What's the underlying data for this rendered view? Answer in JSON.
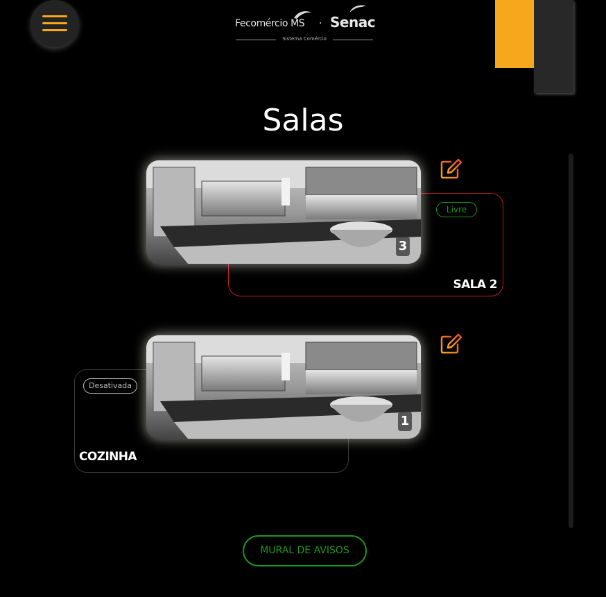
{
  "header": {
    "menu_icon": "hamburger-menu-icon",
    "logo": {
      "fecomercio": "Fecomércio MS",
      "separator": "·",
      "senac": "Senac",
      "tagline": "Sistema Comércio"
    }
  },
  "page": {
    "title": "Salas"
  },
  "rooms": [
    {
      "name": "SALA 2",
      "status": "Livre",
      "count": "3",
      "status_color": "#1e9a1e",
      "border_color": "#c31a24",
      "edit_icon": "edit-pencil-icon"
    },
    {
      "name": "COZINHA",
      "status": "Desativada",
      "count": "1",
      "status_color": "#bdbdbd",
      "border_color": "#3a3a3a",
      "edit_icon": "edit-pencil-icon"
    }
  ],
  "footer": {
    "mural_label": "MURAL DE AVISOS"
  },
  "colors": {
    "accent": "#f5a81c",
    "green": "#1a9a1a",
    "red": "#c31a24",
    "background": "#000000"
  }
}
